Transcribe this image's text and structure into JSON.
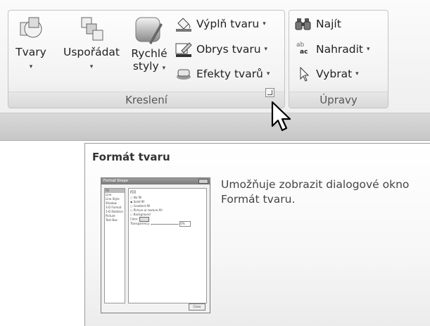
{
  "ribbon": {
    "drawing_group": {
      "label": "Kreslení",
      "shapes_label": "Tvary",
      "arrange_label": "Uspořádat",
      "quick_styles_label_1": "Rychlé",
      "quick_styles_label_2": "styly",
      "fill_label": "Výplň tvaru",
      "outline_label": "Obrys tvaru",
      "effects_label": "Efekty tvarů",
      "dropdown_glyph": "▾"
    },
    "editing_group": {
      "label": "Úpravy",
      "find_label": "Najít",
      "replace_label": "Nahradit",
      "select_label": "Vybrat",
      "replace_icon_top": "ab",
      "replace_icon_bottom": "ac"
    }
  },
  "tooltip": {
    "title": "Formát tvaru",
    "description": "Umožňuje zobrazit dialogové okno Formát tvaru.",
    "thumbnail": {
      "title": "Format Shape",
      "nav_items": [
        "Fill",
        "Line",
        "Line Style",
        "Shadow",
        "3-D Format",
        "3-D Rotation",
        "Picture",
        "Text Box"
      ],
      "section_title": "Fill",
      "options": [
        "No fill",
        "Solid fill",
        "Gradient fill",
        "Picture or texture fill",
        "Background"
      ],
      "color_label": "Color:",
      "transparency_label": "Transparency:",
      "transparency_value": "0%",
      "close_label": "Close"
    }
  }
}
